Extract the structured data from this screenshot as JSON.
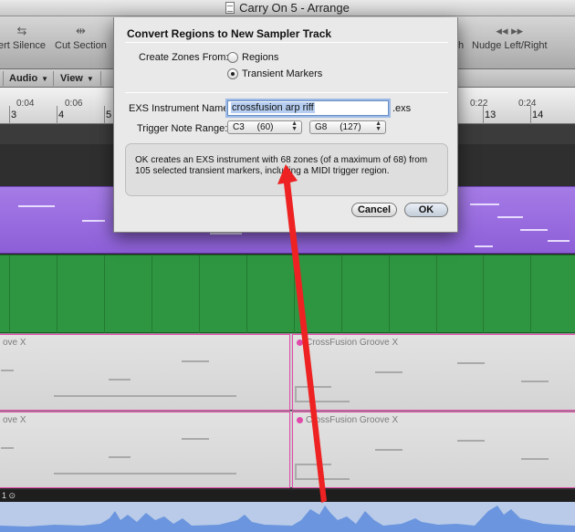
{
  "window": {
    "title": "Carry On 5 - Arrange"
  },
  "toolbar": {
    "items": [
      {
        "label": "ert Silence"
      },
      {
        "label": "Cut Section"
      },
      {
        "label": "h"
      },
      {
        "label": "Nudge Left/Right"
      }
    ]
  },
  "menus": {
    "audio": "Audio",
    "view": "View"
  },
  "ruler": {
    "times": [
      "0:04",
      "0:06",
      "0:22",
      "0:24"
    ],
    "bars": [
      "3",
      "4",
      "5",
      "13",
      "14"
    ]
  },
  "regions": {
    "row1_left": "ove X",
    "row1_right": "CrossFusion Groove X",
    "row2_left": "ove X",
    "row2_right": "CrossFusion Groove X"
  },
  "bottom_label": "1",
  "dialog": {
    "title": "Convert Regions to New Sampler Track",
    "create_zones_label": "Create Zones From:",
    "option_regions": "Regions",
    "option_transient": "Transient Markers",
    "selected_option": "Transient Markers",
    "exs_name_label": "EXS Instrument Name:",
    "exs_name_value": "crossfusion arp riff",
    "exs_extension": ".exs",
    "trigger_range_label": "Trigger Note Range:",
    "trigger_low": "C3     (60)",
    "trigger_high": "G8     (127)",
    "info_text": "OK creates an EXS instrument with 68 zones (of a maximum of 68) from 105 selected transient markers, including a MIDI trigger region.",
    "cancel_label": "Cancel",
    "ok_label": "OK"
  },
  "colors": {
    "annotation_arrow": "#ee2222",
    "track_purple": "#9b6ee0",
    "track_green": "#2e9640",
    "region_border": "#e04aa8"
  }
}
